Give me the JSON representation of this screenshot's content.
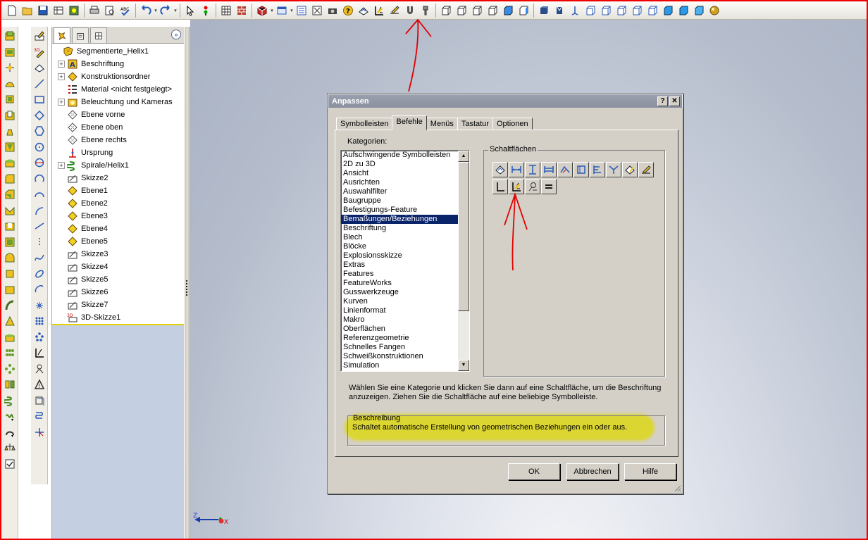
{
  "toolbar": {
    "icons": [
      "new-document",
      "open-folder",
      "save",
      "print-preview-grid",
      "options",
      "print",
      "print-preview",
      "spell-check",
      "undo",
      "redo",
      "select-arrow",
      "rebuild-traffic-light",
      "grid",
      "brick-texture",
      "box-3d",
      "view-orientation",
      "list",
      "fit-zoom",
      "camera",
      "help-question",
      "smart-dimension",
      "add-relation",
      "sketch-tool",
      "wrench",
      "fastener",
      "view-front",
      "view-back",
      "view-left",
      "view-right",
      "view-top",
      "view-bottom",
      "view-iso",
      "view-trimetric",
      "view-dimetric",
      "normal-to",
      "wireframe",
      "hidden-lines",
      "shaded",
      "appearance"
    ]
  },
  "tree": {
    "root": "Segmentierte_Helix1",
    "items": [
      {
        "label": "Beschriftung",
        "icon": "annotation-icon",
        "toggle": "+"
      },
      {
        "label": "Konstruktionsordner",
        "icon": "design-binder-icon",
        "toggle": "+"
      },
      {
        "label": "Material <nicht festgelegt>",
        "icon": "material-icon",
        "toggle": ""
      },
      {
        "label": "Beleuchtung und Kameras",
        "icon": "lights-icon",
        "toggle": "+"
      },
      {
        "label": "Ebene vorne",
        "icon": "plane-icon",
        "toggle": ""
      },
      {
        "label": "Ebene oben",
        "icon": "plane-icon",
        "toggle": ""
      },
      {
        "label": "Ebene rechts",
        "icon": "plane-icon",
        "toggle": ""
      },
      {
        "label": "Ursprung",
        "icon": "origin-icon",
        "toggle": ""
      },
      {
        "label": "Spirale/Helix1",
        "icon": "helix-icon",
        "toggle": "+"
      },
      {
        "label": "Skizze2",
        "icon": "sketch-icon",
        "toggle": ""
      },
      {
        "label": "Ebene1",
        "icon": "plane-yellow-icon",
        "toggle": ""
      },
      {
        "label": "Ebene2",
        "icon": "plane-yellow-icon",
        "toggle": ""
      },
      {
        "label": "Ebene3",
        "icon": "plane-yellow-icon",
        "toggle": ""
      },
      {
        "label": "Ebene4",
        "icon": "plane-yellow-icon",
        "toggle": ""
      },
      {
        "label": "Ebene5",
        "icon": "plane-yellow-icon",
        "toggle": ""
      },
      {
        "label": "Skizze3",
        "icon": "sketch-icon",
        "toggle": ""
      },
      {
        "label": "Skizze4",
        "icon": "sketch-icon",
        "toggle": ""
      },
      {
        "label": "Skizze5",
        "icon": "sketch-icon",
        "toggle": ""
      },
      {
        "label": "Skizze6",
        "icon": "sketch-icon",
        "toggle": ""
      },
      {
        "label": "Skizze7",
        "icon": "sketch-icon",
        "toggle": ""
      },
      {
        "label": "3D-Skizze1",
        "icon": "sketch-3d-icon",
        "toggle": ""
      }
    ]
  },
  "dialog": {
    "title": "Anpassen",
    "help_btn": "?",
    "close_btn": "✕",
    "tabs": [
      "Symbolleisten",
      "Befehle",
      "Menüs",
      "Tastatur",
      "Optionen"
    ],
    "active_tab": 1,
    "categories_label": "Kategorien:",
    "categories": [
      "Aufschwingende Symbolleisten",
      "2D zu 3D",
      "Ansicht",
      "Ausrichten",
      "Auswahlfilter",
      "Baugruppe",
      "Befestigungs-Feature",
      "Bemaßungen/Beziehungen",
      "Beschriftung",
      "Blech",
      "Blöcke",
      "Explosionsskizze",
      "Extras",
      "Features",
      "FeatureWorks",
      "Gusswerkzeuge",
      "Kurven",
      "Linienformat",
      "Makro",
      "Oberflächen",
      "Referenzgeometrie",
      "Schnelles Fangen",
      "Schweißkonstruktionen",
      "Simulation"
    ],
    "selected_category": 7,
    "buttons_group": "Schaltflächen",
    "help_text": "Wählen Sie eine Kategorie und klicken Sie dann auf eine Schaltfläche, um die Beschriftung anzuzeigen. Ziehen Sie die Schaltfläche auf eine beliebige Symbolleiste.",
    "description_title": "Beschreibung",
    "description": "Schaltet automatische Erstellung von geometrischen Beziehungen ein oder aus.",
    "ok": "OK",
    "cancel": "Abbrechen",
    "help": "Hilfe"
  },
  "triad": {
    "z_label": "Z",
    "x_label": "X"
  },
  "colors": {
    "annotation_red": "#e00000",
    "highlight_yellow": "#dfd800",
    "selection": "#0a246a"
  }
}
